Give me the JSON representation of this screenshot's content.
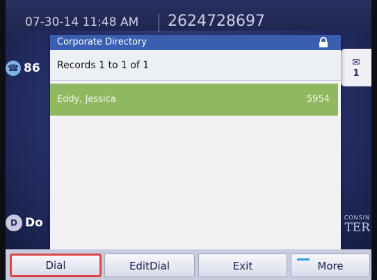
{
  "header": {
    "datetime": "07-30-14 11:48 AM",
    "phone_number": "2624728697"
  },
  "left_panel": {
    "line_label": "86",
    "dnd_label": "Do"
  },
  "messages": {
    "count": "1"
  },
  "brand": {
    "line1": "CONSIN",
    "line2": "TER"
  },
  "dialog": {
    "title": "Corporate Directory",
    "records_text": "Records 1 to 1 of 1",
    "results": [
      {
        "name": "Eddy, Jessica",
        "extension": "5954"
      }
    ]
  },
  "softkeys": {
    "dial": "Dial",
    "editdial": "EditDial",
    "exit": "Exit",
    "more": "More"
  },
  "colors": {
    "title_bar": "#3b5fb0",
    "selected_row": "#8fb860",
    "highlight_border": "#e04545",
    "background": "#2a3060"
  }
}
